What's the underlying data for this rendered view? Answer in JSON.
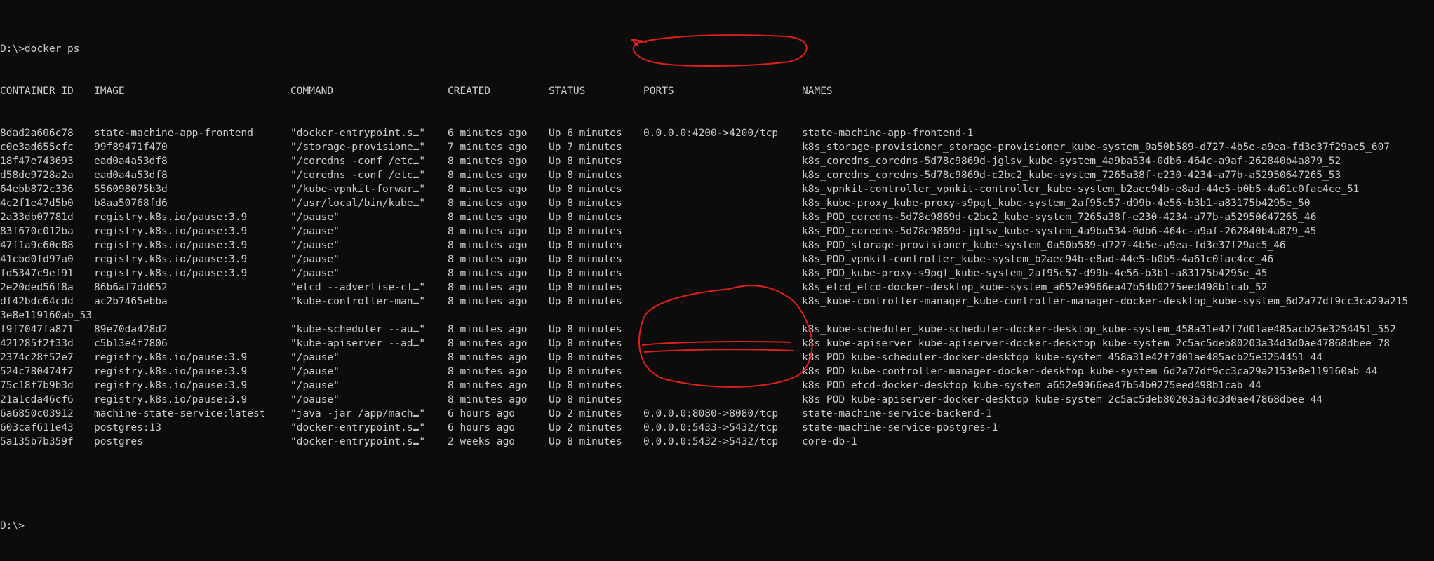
{
  "terminal": {
    "prompt_command": "D:\\>docker ps",
    "headers": {
      "id": "CONTAINER ID",
      "image": "IMAGE",
      "command": "COMMAND",
      "created": "CREATED",
      "status": "STATUS",
      "ports": "PORTS",
      "names": "NAMES"
    },
    "rows": [
      {
        "id": "8dad2a606c78",
        "image": "state-machine-app-frontend",
        "command": "\"docker-entrypoint.s…\"",
        "created": "6 minutes ago",
        "status": "Up 6 minutes",
        "ports": "0.0.0.0:4200->4200/tcp",
        "names": "state-machine-app-frontend-1"
      },
      {
        "id": "c0e3ad655cfc",
        "image": "99f89471f470",
        "command": "\"/storage-provisione…\"",
        "created": "7 minutes ago",
        "status": "Up 7 minutes",
        "ports": "",
        "names": "k8s_storage-provisioner_storage-provisioner_kube-system_0a50b589-d727-4b5e-a9ea-fd3e37f29ac5_607"
      },
      {
        "id": "18f47e743693",
        "image": "ead0a4a53df8",
        "command": "\"/coredns -conf /etc…\"",
        "created": "8 minutes ago",
        "status": "Up 8 minutes",
        "ports": "",
        "names": "k8s_coredns_coredns-5d78c9869d-jglsv_kube-system_4a9ba534-0db6-464c-a9af-262840b4a879_52"
      },
      {
        "id": "d58de9728a2a",
        "image": "ead0a4a53df8",
        "command": "\"/coredns -conf /etc…\"",
        "created": "8 minutes ago",
        "status": "Up 8 minutes",
        "ports": "",
        "names": "k8s_coredns_coredns-5d78c9869d-c2bc2_kube-system_7265a38f-e230-4234-a77b-a52950647265_53"
      },
      {
        "id": "64ebb872c336",
        "image": "556098075b3d",
        "command": "\"/kube-vpnkit-forwar…\"",
        "created": "8 minutes ago",
        "status": "Up 8 minutes",
        "ports": "",
        "names": "k8s_vpnkit-controller_vpnkit-controller_kube-system_b2aec94b-e8ad-44e5-b0b5-4a61c0fac4ce_51"
      },
      {
        "id": "4c2f1e47d5b0",
        "image": "b8aa50768fd6",
        "command": "\"/usr/local/bin/kube…\"",
        "created": "8 minutes ago",
        "status": "Up 8 minutes",
        "ports": "",
        "names": "k8s_kube-proxy_kube-proxy-s9pgt_kube-system_2af95c57-d99b-4e56-b3b1-a83175b4295e_50"
      },
      {
        "id": "2a33db07781d",
        "image": "registry.k8s.io/pause:3.9",
        "command": "\"/pause\"",
        "created": "8 minutes ago",
        "status": "Up 8 minutes",
        "ports": "",
        "names": "k8s_POD_coredns-5d78c9869d-c2bc2_kube-system_7265a38f-e230-4234-a77b-a52950647265_46"
      },
      {
        "id": "83f670c012ba",
        "image": "registry.k8s.io/pause:3.9",
        "command": "\"/pause\"",
        "created": "8 minutes ago",
        "status": "Up 8 minutes",
        "ports": "",
        "names": "k8s_POD_coredns-5d78c9869d-jglsv_kube-system_4a9ba534-0db6-464c-a9af-262840b4a879_45"
      },
      {
        "id": "47f1a9c60e88",
        "image": "registry.k8s.io/pause:3.9",
        "command": "\"/pause\"",
        "created": "8 minutes ago",
        "status": "Up 8 minutes",
        "ports": "",
        "names": "k8s_POD_storage-provisioner_kube-system_0a50b589-d727-4b5e-a9ea-fd3e37f29ac5_46"
      },
      {
        "id": "41cbd0fd97a0",
        "image": "registry.k8s.io/pause:3.9",
        "command": "\"/pause\"",
        "created": "8 minutes ago",
        "status": "Up 8 minutes",
        "ports": "",
        "names": "k8s_POD_vpnkit-controller_kube-system_b2aec94b-e8ad-44e5-b0b5-4a61c0fac4ce_46"
      },
      {
        "id": "fd5347c9ef91",
        "image": "registry.k8s.io/pause:3.9",
        "command": "\"/pause\"",
        "created": "8 minutes ago",
        "status": "Up 8 minutes",
        "ports": "",
        "names": "k8s_POD_kube-proxy-s9pgt_kube-system_2af95c57-d99b-4e56-b3b1-a83175b4295e_45"
      },
      {
        "id": "2e20ded56f8a",
        "image": "86b6af7dd652",
        "command": "\"etcd --advertise-cl…\"",
        "created": "8 minutes ago",
        "status": "Up 8 minutes",
        "ports": "",
        "names": "k8s_etcd_etcd-docker-desktop_kube-system_a652e9966ea47b54b0275eed498b1cab_52"
      },
      {
        "id": "df42bdc64cdd",
        "image": "ac2b7465ebba",
        "command": "\"kube-controller-man…\"",
        "created": "8 minutes ago",
        "status": "Up 8 minutes",
        "ports": "",
        "names": "k8s_kube-controller-manager_kube-controller-manager-docker-desktop_kube-system_6d2a77df9cc3ca29a215"
      },
      {
        "wrap": "3e8e119160ab_53"
      },
      {
        "id": "f9f7047fa871",
        "image": "89e70da428d2",
        "command": "\"kube-scheduler --au…\"",
        "created": "8 minutes ago",
        "status": "Up 8 minutes",
        "ports": "",
        "names": "k8s_kube-scheduler_kube-scheduler-docker-desktop_kube-system_458a31e42f7d01ae485acb25e3254451_552"
      },
      {
        "id": "421285f2f33d",
        "image": "c5b13e4f7806",
        "command": "\"kube-apiserver --ad…\"",
        "created": "8 minutes ago",
        "status": "Up 8 minutes",
        "ports": "",
        "names": "k8s_kube-apiserver_kube-apiserver-docker-desktop_kube-system_2c5ac5deb80203a34d3d0ae47868dbee_78"
      },
      {
        "id": "2374c28f52e7",
        "image": "registry.k8s.io/pause:3.9",
        "command": "\"/pause\"",
        "created": "8 minutes ago",
        "status": "Up 8 minutes",
        "ports": "",
        "names": "k8s_POD_kube-scheduler-docker-desktop_kube-system_458a31e42f7d01ae485acb25e3254451_44"
      },
      {
        "id": "524c780474f7",
        "image": "registry.k8s.io/pause:3.9",
        "command": "\"/pause\"",
        "created": "8 minutes ago",
        "status": "Up 8 minutes",
        "ports": "",
        "names": "k8s_POD_kube-controller-manager-docker-desktop_kube-system_6d2a77df9cc3ca29a2153e8e119160ab_44"
      },
      {
        "id": "75c18f7b9b3d",
        "image": "registry.k8s.io/pause:3.9",
        "command": "\"/pause\"",
        "created": "8 minutes ago",
        "status": "Up 8 minutes",
        "ports": "",
        "names": "k8s_POD_etcd-docker-desktop_kube-system_a652e9966ea47b54b0275eed498b1cab_44"
      },
      {
        "id": "21a1cda46cf6",
        "image": "registry.k8s.io/pause:3.9",
        "command": "\"/pause\"",
        "created": "8 minutes ago",
        "status": "Up 8 minutes",
        "ports": "",
        "names": "k8s_POD_kube-apiserver-docker-desktop_kube-system_2c5ac5deb80203a34d3d0ae47868dbee_44"
      },
      {
        "id": "6a6850c03912",
        "image": "machine-state-service:latest",
        "command": "\"java -jar /app/mach…\"",
        "created": "6 hours ago",
        "status": "Up 2 minutes",
        "ports": "0.0.0.0:8080->8080/tcp",
        "names": "state-machine-service-backend-1"
      },
      {
        "id": "603caf611e43",
        "image": "postgres:13",
        "command": "\"docker-entrypoint.s…\"",
        "created": "6 hours ago",
        "status": "Up 2 minutes",
        "ports": "0.0.0.0:5433->5432/tcp",
        "names": "state-machine-service-postgres-1"
      },
      {
        "id": "5a135b7b359f",
        "image": "postgres",
        "command": "\"docker-entrypoint.s…\"",
        "created": "2 weeks ago",
        "status": "Up 8 minutes",
        "ports": "0.0.0.0:5432->5432/tcp",
        "names": "core-db-1"
      }
    ],
    "final_prompt": "D:\\>",
    "annotation_color": "#e0201b"
  }
}
